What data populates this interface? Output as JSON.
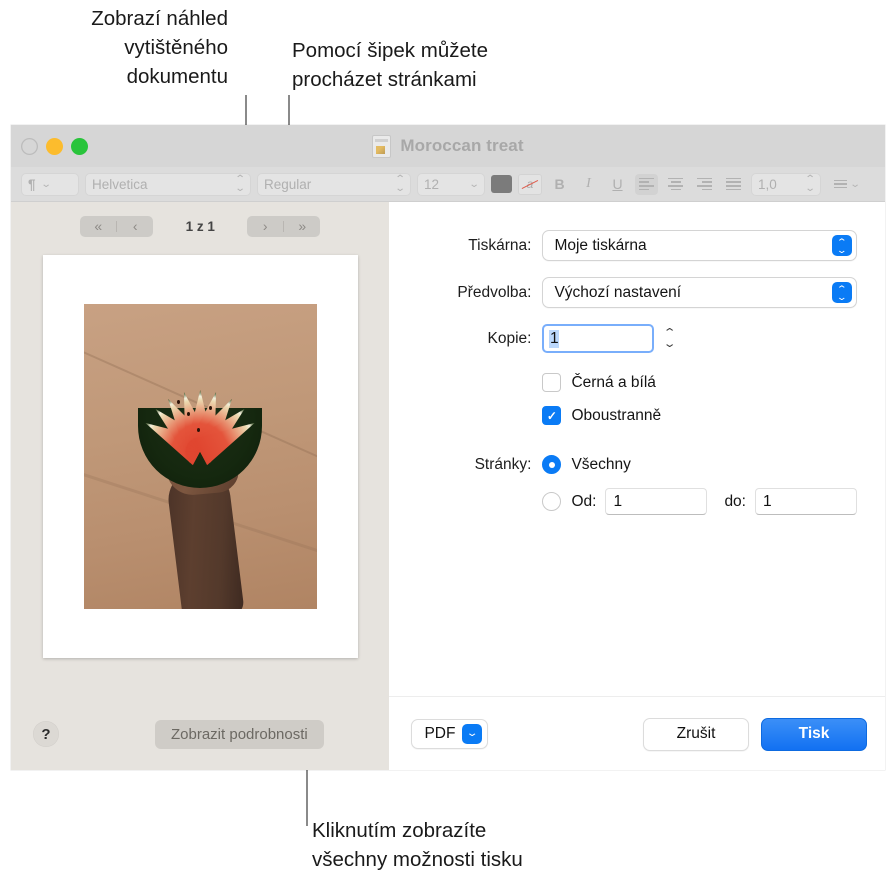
{
  "callouts": {
    "preview": "Zobrazí náhled\nvytištěného\ndokumentu",
    "arrows": "Pomocí šipek můžete\nprocházet stránkami",
    "details": "Kliknutím zobrazíte\nvšechny možnosti tisku"
  },
  "window": {
    "title": "Moroccan treat",
    "doc_icon": "document-icon"
  },
  "toolbar": {
    "paragraph_style": "¶",
    "font_family": "Helvetica",
    "font_style": "Regular",
    "font_size": "12",
    "color_swatch": "#7b7b7b",
    "highlight": "a",
    "bold": "B",
    "italic": "I",
    "underline": "U",
    "line_spacing": "1,0",
    "list": "list-icon"
  },
  "preview": {
    "first_page_icon": "«",
    "prev_page_icon": "‹",
    "next_page_icon": "›",
    "last_page_icon": "»",
    "page_indicator": "1 z 1",
    "help_label": "?",
    "show_details_label": "Zobrazit podrobnosti"
  },
  "options": {
    "printer_label": "Tiskárna:",
    "printer_value": "Moje tiskárna",
    "preset_label": "Předvolba:",
    "preset_value": "Výchozí nastavení",
    "copies_label": "Kopie:",
    "copies_value": "1",
    "bw_label": "Černá a bílá",
    "bw_checked": false,
    "duplex_label": "Oboustranně",
    "duplex_checked": true,
    "duplex_check_glyph": "✓",
    "pages_label": "Stránky:",
    "pages_all_label": "Všechny",
    "pages_from_label": "Od:",
    "pages_from_value": "1",
    "pages_to_label": "do:",
    "pages_to_value": "1"
  },
  "actions": {
    "pdf_label": "PDF",
    "pdf_chevron": "⌄",
    "cancel_label": "Zrušit",
    "print_label": "Tisk"
  },
  "colors": {
    "accent": "#0a7bf5",
    "print_button": "#1271f2",
    "preview_pane_bg": "#e6e3de",
    "traffic_yellow": "#fcbc2d",
    "traffic_green": "#29c43b"
  }
}
